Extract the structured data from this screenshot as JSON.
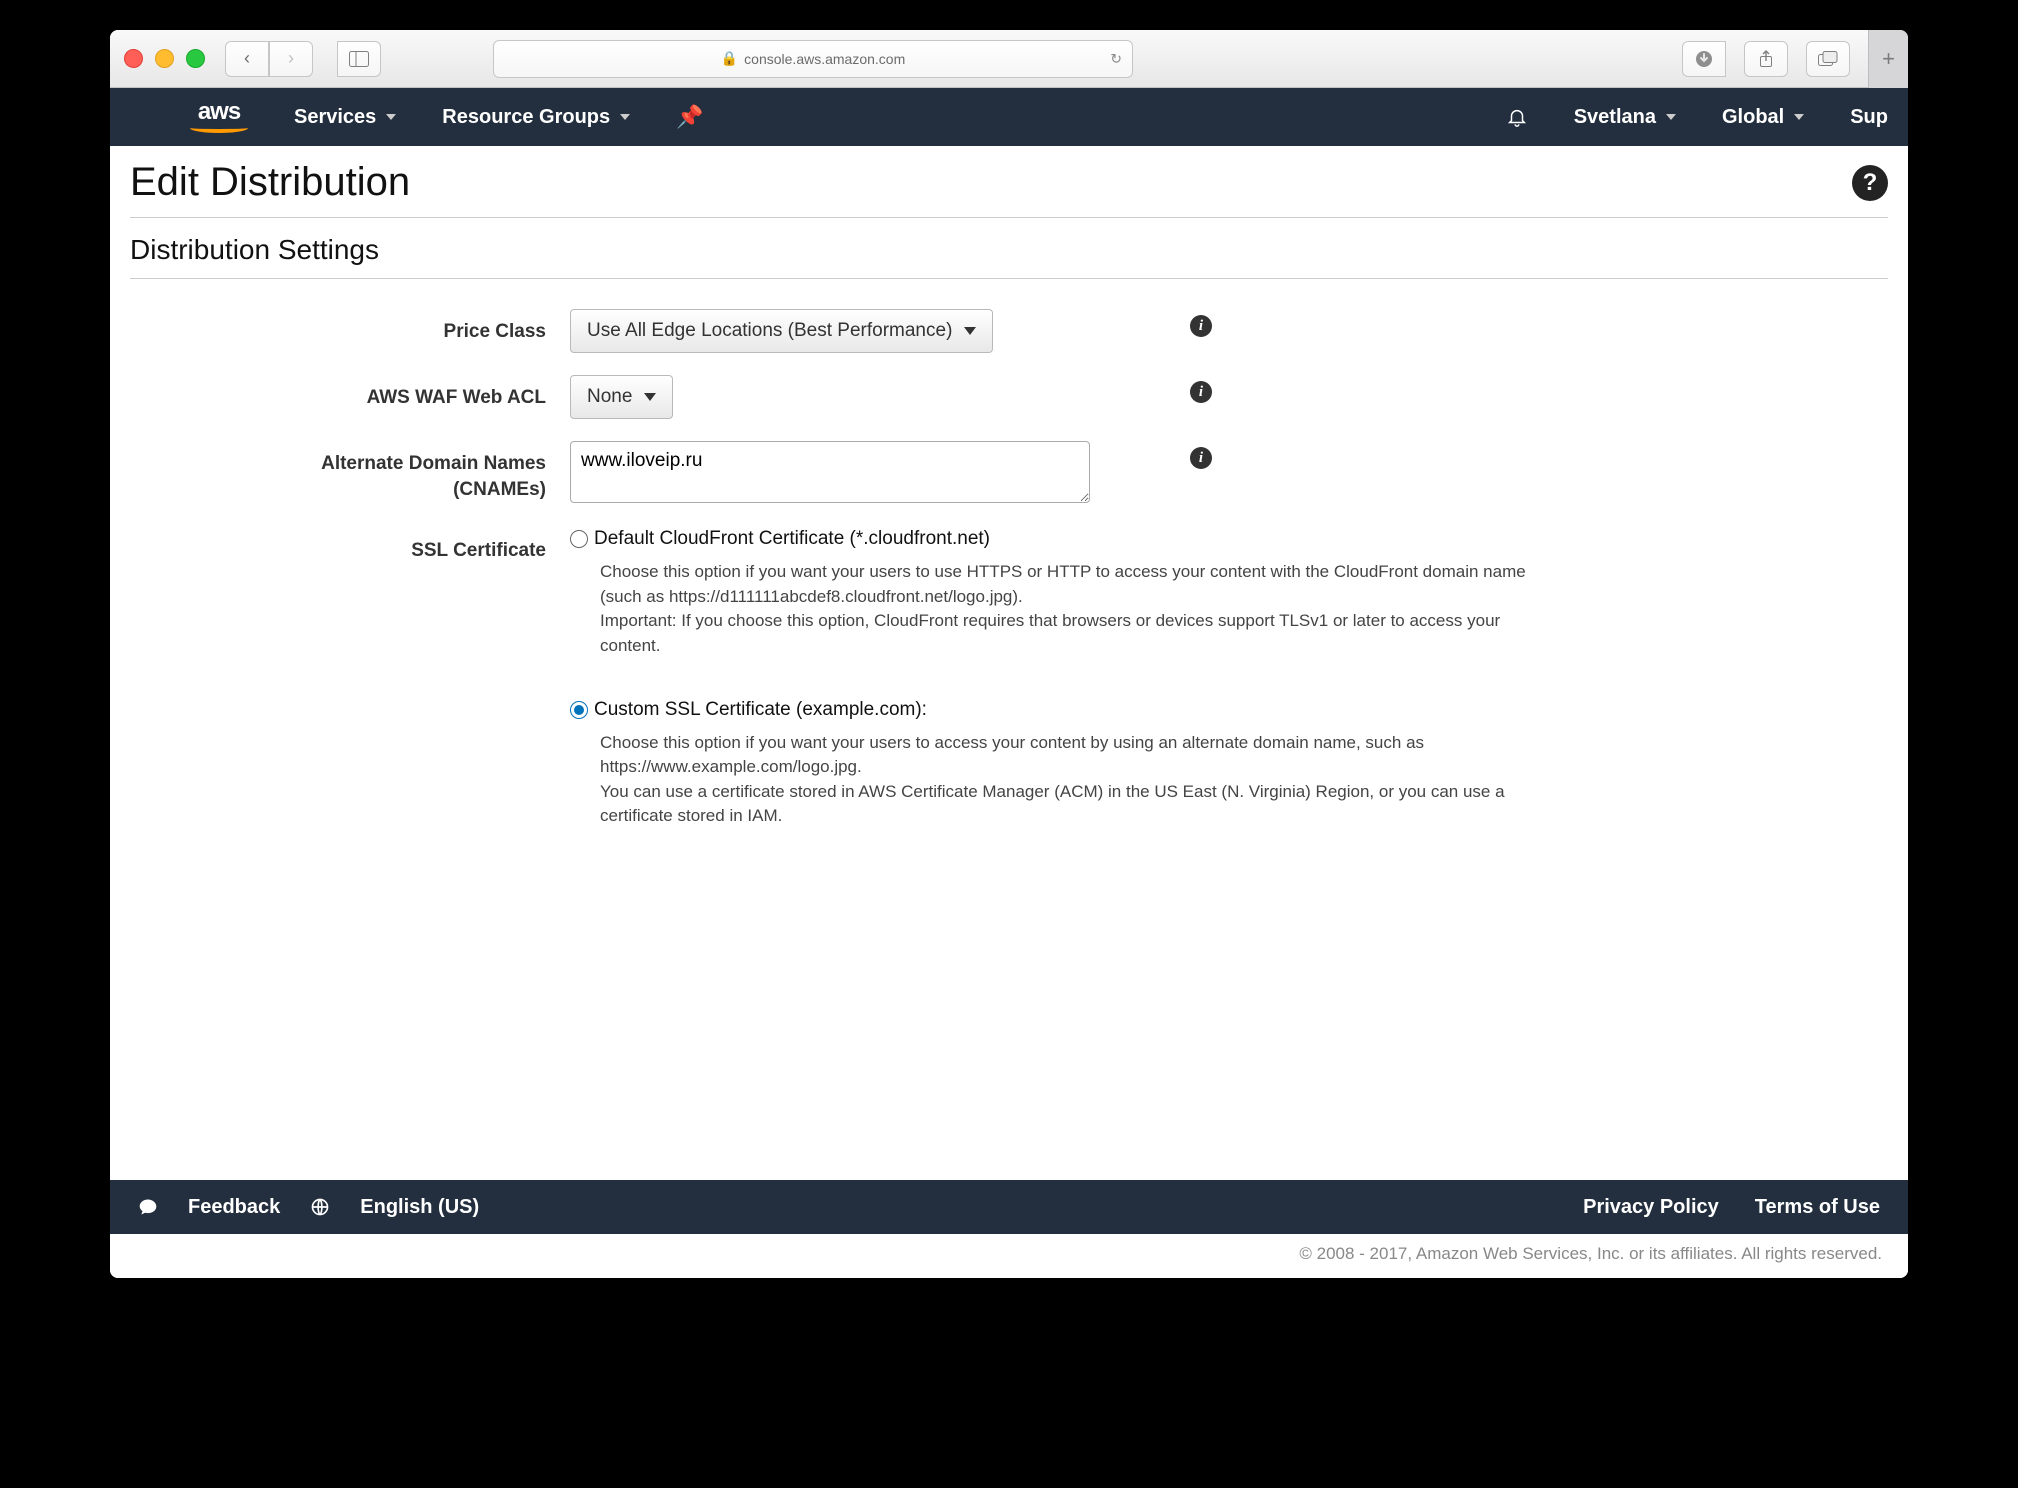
{
  "browser": {
    "url_display": "console.aws.amazon.com"
  },
  "nav": {
    "services": "Services",
    "resource_groups": "Resource Groups",
    "user": "Svetlana",
    "region": "Global",
    "support": "Sup"
  },
  "page": {
    "title": "Edit Distribution",
    "subtitle": "Distribution Settings"
  },
  "form": {
    "price_class": {
      "label": "Price Class",
      "value": "Use All Edge Locations (Best Performance)"
    },
    "waf": {
      "label": "AWS WAF Web ACL",
      "value": "None"
    },
    "cnames": {
      "label": "Alternate Domain Names\n(CNAMEs)",
      "value": "www.iloveip.ru"
    },
    "ssl": {
      "label": "SSL Certificate",
      "default_option": "Default CloudFront Certificate (*.cloudfront.net)",
      "default_desc": "Choose this option if you want your users to use HTTPS or HTTP to access your content with the CloudFront domain name (such as https://d111111abcdef8.cloudfront.net/logo.jpg).\nImportant: If you choose this option, CloudFront requires that browsers or devices support TLSv1 or later to access your content.",
      "custom_option": "Custom SSL Certificate (example.com):",
      "custom_desc": "Choose this option if you want your users to access your content by using an alternate domain name, such as https://www.example.com/logo.jpg.\nYou can use a certificate stored in AWS Certificate Manager (ACM) in the US East (N. Virginia) Region, or you can use a certificate stored in IAM."
    }
  },
  "footer": {
    "feedback": "Feedback",
    "language": "English (US)",
    "privacy": "Privacy Policy",
    "terms": "Terms of Use",
    "copyright": "© 2008 - 2017, Amazon Web Services, Inc. or its affiliates. All rights reserved."
  }
}
